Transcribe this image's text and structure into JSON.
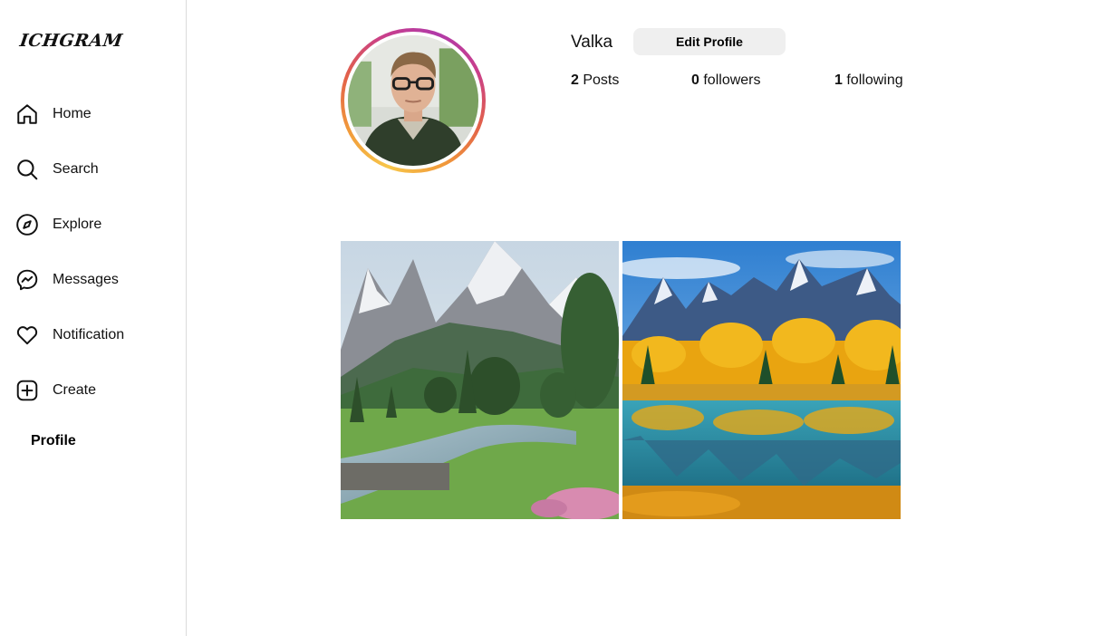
{
  "app": {
    "logo_text": "ICHGRAM"
  },
  "sidebar": {
    "items": [
      {
        "label": "Home",
        "icon": "home-icon"
      },
      {
        "label": "Search",
        "icon": "search-icon"
      },
      {
        "label": "Explore",
        "icon": "compass-icon"
      },
      {
        "label": "Messages",
        "icon": "messenger-icon"
      },
      {
        "label": "Notification",
        "icon": "heart-icon"
      },
      {
        "label": "Create",
        "icon": "plus-square-icon"
      }
    ],
    "profile_label": "Profile"
  },
  "profile": {
    "username": "Valka",
    "edit_button": "Edit Profile",
    "stats": {
      "posts_count": "2",
      "posts_label": "Posts",
      "followers_count": "0",
      "followers_label": "followers",
      "following_count": "1",
      "following_label": "following"
    }
  },
  "posts": [
    {
      "subject": "mountain-meadow-stream"
    },
    {
      "subject": "autumn-mountain-lake"
    }
  ],
  "colors": {
    "ring_start": "#b13aa8",
    "ring_end": "#f7c64a",
    "button_bg": "#efefef",
    "divider": "#dbdbdb"
  }
}
